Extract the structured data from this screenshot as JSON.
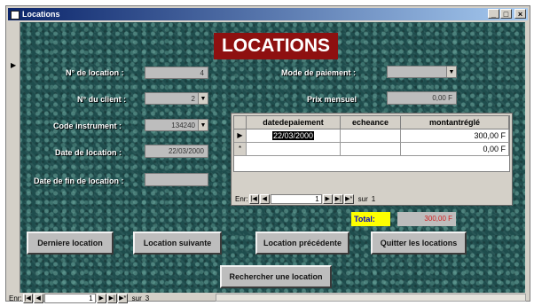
{
  "window": {
    "title": "Locations",
    "buttons": [
      "_",
      "□",
      "×"
    ]
  },
  "form_title": "LOCATIONS",
  "fields": {
    "no_location": {
      "label": "N° de location :",
      "value": "4"
    },
    "no_client": {
      "label": "N° du client :",
      "value": "2"
    },
    "code_instrument": {
      "label": "Code instrument :",
      "value": "134240"
    },
    "date_location": {
      "label": "Date de location :",
      "value": "22/03/2000"
    },
    "date_fin_location": {
      "label": "Date de fin de location :",
      "value": ""
    },
    "mode_paiement": {
      "label": "Mode de paiement :",
      "value": ""
    },
    "prix_mensuel": {
      "label": "Prix mensuel",
      "value": "0,00 F"
    }
  },
  "subform": {
    "columns": [
      "datedepaiement",
      "echeance",
      "montantréglé"
    ],
    "rows": [
      {
        "selector": "▶",
        "datedepaiement": "22/03/2000",
        "echeance": "",
        "montant": "300,00 F"
      },
      {
        "selector": "*",
        "datedepaiement": "",
        "echeance": "",
        "montant": "0,00 F"
      }
    ],
    "nav": {
      "label": "Enr:",
      "current": "1",
      "of_label": "sur",
      "total": "1"
    }
  },
  "total": {
    "label": "Total:",
    "value": "300,00 F"
  },
  "buttons": {
    "derniere": "Derniere location",
    "suivante": "Location suivante",
    "precedente": "Location précédente",
    "quitter": "Quitter les locations",
    "rechercher": "Rechercher une location"
  },
  "main_nav": {
    "label": "Enr:",
    "current": "1",
    "of_label": "sur",
    "total": "3"
  },
  "colors": {
    "title_bg": "#8e1010",
    "form_bg": "#1f4d4d",
    "total_label_bg": "#ffff00",
    "total_value_text": "#d02020"
  },
  "icons": [
    "form-icon",
    "record-selector-arrow-icon",
    "combo-dropdown-icon",
    "nav-first-icon",
    "nav-prev-icon",
    "nav-next-icon",
    "nav-last-icon",
    "nav-new-icon"
  ]
}
